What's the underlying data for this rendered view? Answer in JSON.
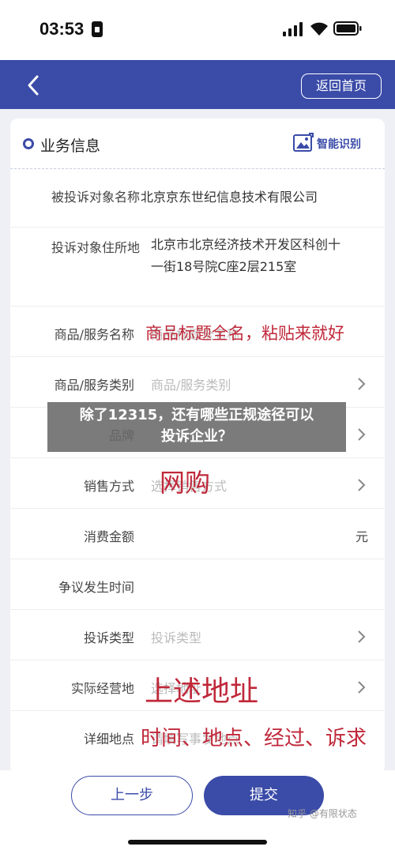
{
  "status_bar": {
    "time": "03:53"
  },
  "nav": {
    "home_label": "返回首页"
  },
  "section": {
    "title": "业务信息",
    "smart_label": "智能识别"
  },
  "rows": [
    {
      "label": "被投诉对象名称",
      "value": "北京京东世纪信息技术有限公司"
    },
    {
      "label": "投诉对象住所地",
      "value_line1": "北京市北京经济技术开发区科创十",
      "value_line2": "一街18号院C座2层215室"
    },
    {
      "label": "商品/服务名称",
      "placeholder": "商品标题全名称"
    },
    {
      "label": "商品/服务类别",
      "placeholder": "商品/服务类别"
    },
    {
      "label": "品牌",
      "placeholder": ""
    },
    {
      "label": "销售方式",
      "placeholder": "选择销售方式"
    },
    {
      "label": "消费金额",
      "unit": "元"
    },
    {
      "label": "争议发生时间"
    },
    {
      "label": "投诉类型",
      "placeholder": "投诉类型"
    },
    {
      "label": "实际经营地",
      "placeholder": "选择地址"
    },
    {
      "label": "详细地点",
      "placeholder": "请填写事发地点"
    }
  ],
  "annotations": {
    "product_name": "商品标题全名，粘贴来就好",
    "sales_method": "网购",
    "business_location": "上述地址",
    "detail_location": "时间、地点、经过、诉求"
  },
  "overlay": {
    "line1": "除了12315，还有哪些正规途径可以",
    "line2": "投诉企业？"
  },
  "buttons": {
    "prev": "上一步",
    "submit": "提交"
  },
  "watermark": "知乎 @有限状态",
  "colors": {
    "primary": "#3a4ba8",
    "annotation": "#c0283a",
    "overlay": "#696969"
  }
}
